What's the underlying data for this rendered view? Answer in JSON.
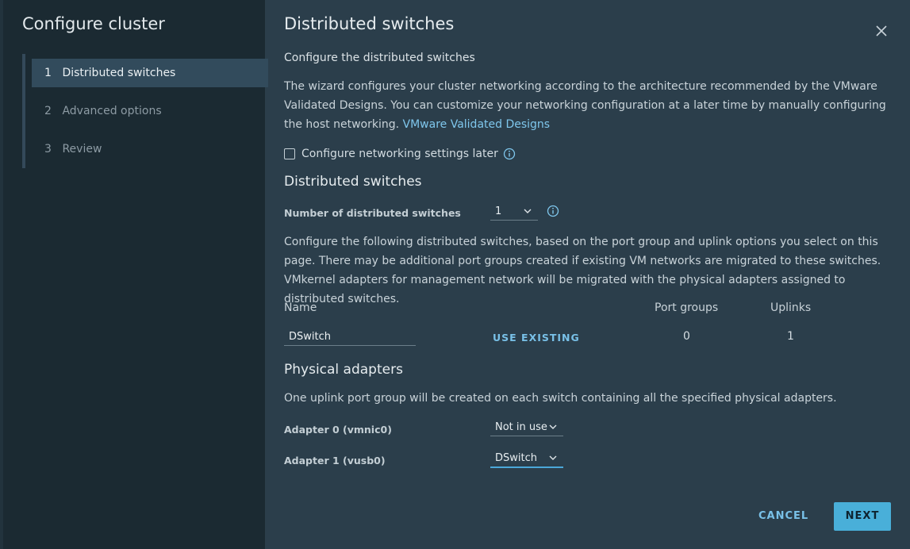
{
  "wizard": {
    "title": "Configure cluster",
    "steps": [
      {
        "num": "1",
        "label": "Distributed switches"
      },
      {
        "num": "2",
        "label": "Advanced options"
      },
      {
        "num": "3",
        "label": "Review"
      }
    ],
    "active_step": 1
  },
  "page": {
    "title": "Distributed switches",
    "subtitle": "Configure the distributed switches",
    "description": "The wizard configures your cluster networking according to the architecture recommended by the VMware Validated Designs. You can customize your networking configuration at a later time by manually configuring the host networking.",
    "link_label": "VMware Validated Designs",
    "configure_later_label": "Configure networking settings later",
    "configure_later_checked": false
  },
  "switches": {
    "heading": "Distributed switches",
    "count_label": "Number of distributed switches",
    "count_value": "1",
    "description": "Configure the following distributed switches, based on the port group and uplink options you select on this page. There may be additional port groups created if existing VM networks are migrated to these switches. VMkernel adapters for management network will be migrated with the physical adapters assigned to distributed switches.",
    "columns": {
      "name": "Name",
      "port_groups": "Port groups",
      "uplinks": "Uplinks"
    },
    "rows": [
      {
        "name": "DSwitch",
        "action": "USE EXISTING",
        "port_groups": "0",
        "uplinks": "1"
      }
    ]
  },
  "adapters": {
    "heading": "Physical adapters",
    "description": "One uplink port group will be created on each switch containing all the specified physical adapters.",
    "items": [
      {
        "label": "Adapter 0 (vmnic0)",
        "value": "Not in use"
      },
      {
        "label": "Adapter 1 (vusb0)",
        "value": "DSwitch"
      }
    ]
  },
  "footer": {
    "cancel_label": "CANCEL",
    "next_label": "NEXT"
  },
  "colors": {
    "accent": "#49afd9",
    "link": "#79c1e8",
    "panel": "#2b3e4b",
    "sidebar": "#1b2a32"
  }
}
